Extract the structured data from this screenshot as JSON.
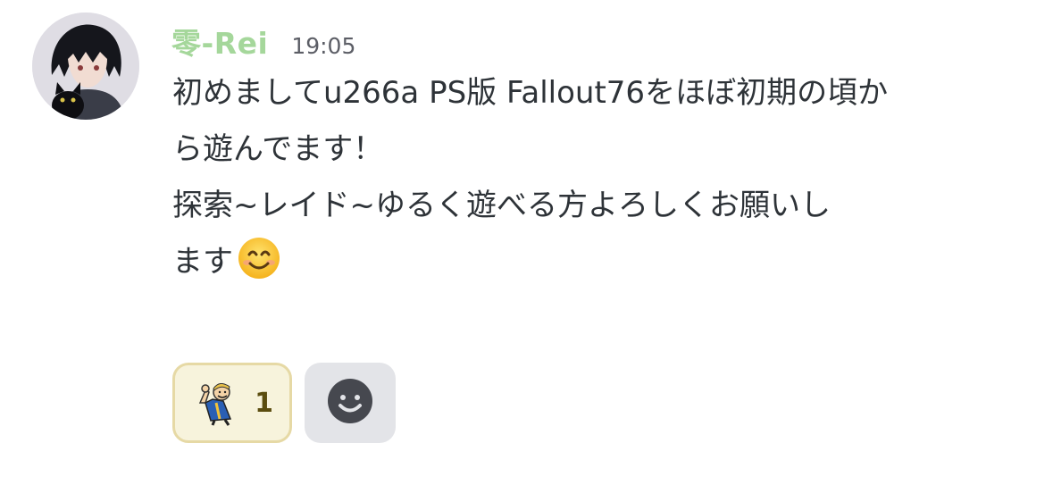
{
  "message": {
    "username": "零-Rei",
    "username_color": "#a5d79b",
    "timestamp": "19:05",
    "lines": [
      "初めましてu266a PS版 Fallout76をほぼ初期の頃か",
      "ら遊んでます！",
      "探索~レイド~ゆるく遊べる方よろしくお願いし",
      "ます"
    ],
    "trailing_emoji": "smiling-face-emoji"
  },
  "reactions": [
    {
      "icon": "vault-boy-thumbs-up-icon",
      "count": "1",
      "reacted": true
    }
  ],
  "add_reaction": {
    "icon": "add-reaction-smiley-icon"
  }
}
